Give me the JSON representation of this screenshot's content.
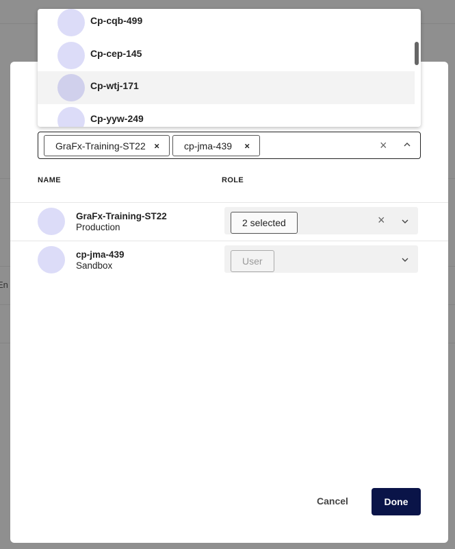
{
  "background": {
    "partial_text": "En"
  },
  "dropdown": {
    "options": [
      {
        "label": "Cp-cqb-499"
      },
      {
        "label": "Cp-cep-145"
      },
      {
        "label": "Cp-wtj-171"
      },
      {
        "label": "Cp-yyw-249"
      }
    ]
  },
  "selection": {
    "chips": [
      {
        "label": "GraFx-Training-ST22",
        "remove": "×"
      },
      {
        "label": "cp-jma-439",
        "remove": "×"
      }
    ],
    "clear_glyph": "×"
  },
  "table": {
    "headers": {
      "name": "NAME",
      "role": "ROLE"
    },
    "rows": [
      {
        "name": "GraFx-Training-ST22",
        "env": "Production",
        "role": "2 selected",
        "clear": "×"
      },
      {
        "name": "cp-jma-439",
        "env": "Sandbox",
        "role": "User"
      }
    ]
  },
  "actions": {
    "cancel": "Cancel",
    "done": "Done"
  },
  "colors": {
    "primary": "#0a1448",
    "avatar": "#dcdcf8"
  }
}
